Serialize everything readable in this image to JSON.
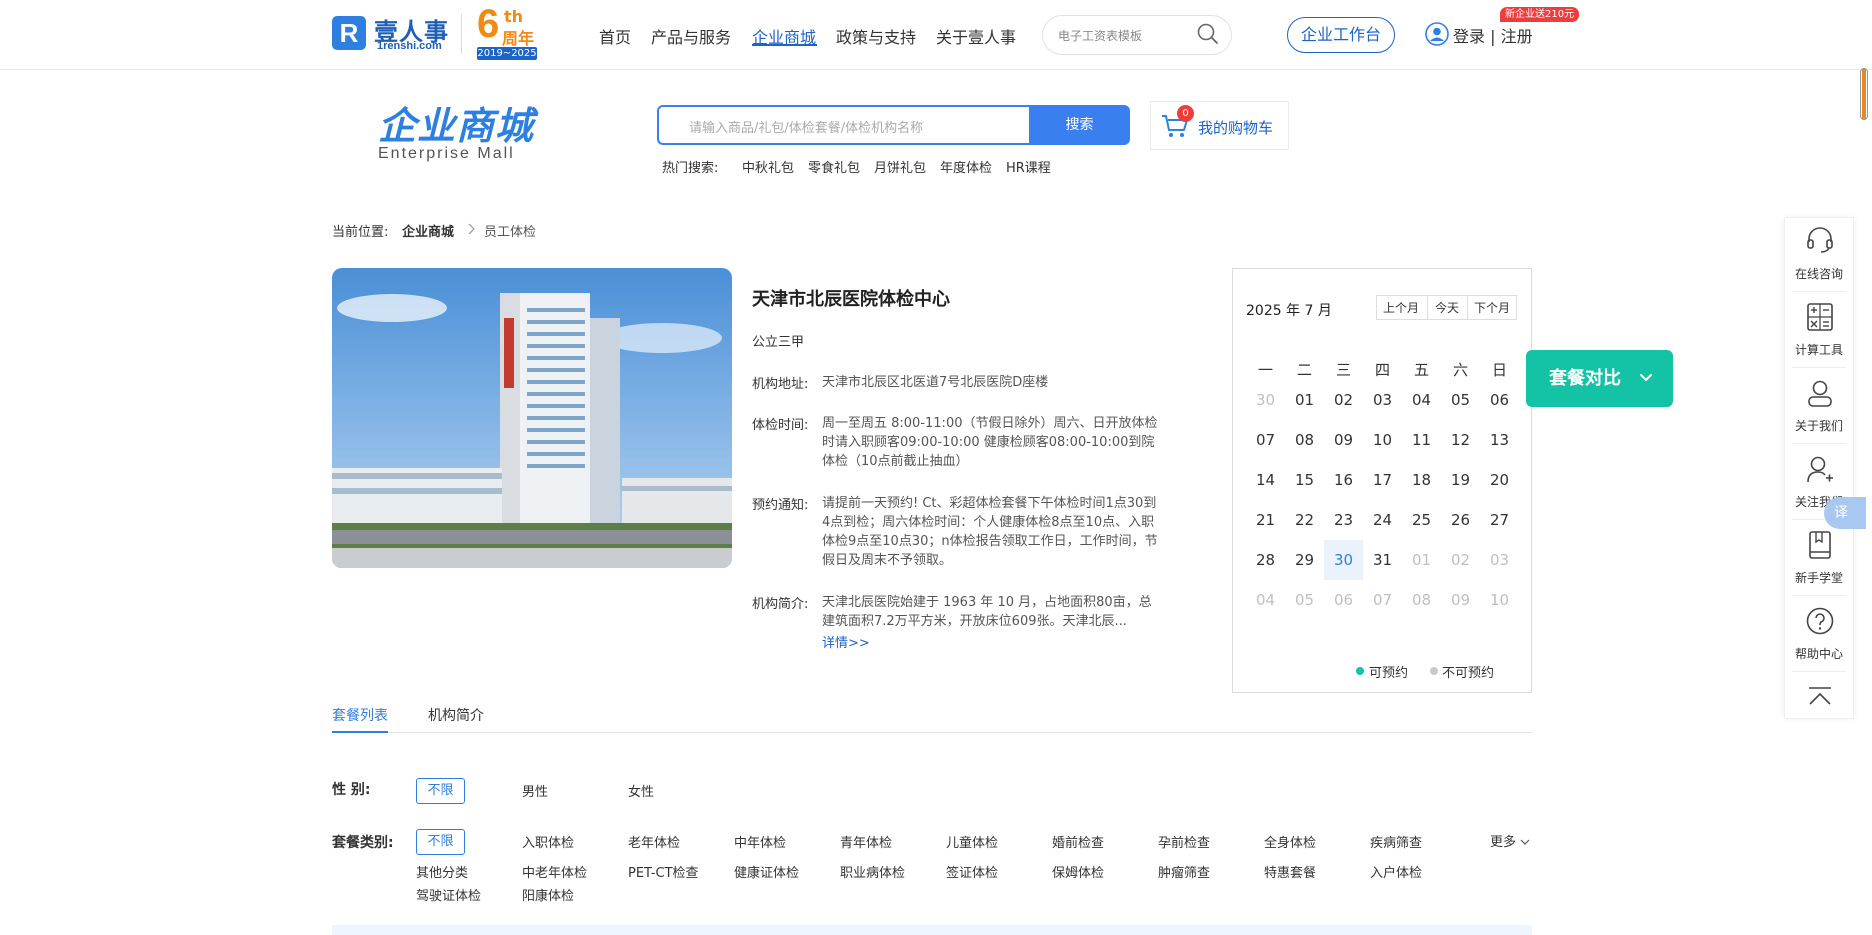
{
  "header": {
    "logo_cn": "壹人事",
    "logo_en": "1renshi.com",
    "anniversary_num": "6",
    "anniversary_th": "th",
    "anniversary_label": "周年",
    "anniversary_years": "2019~2025",
    "nav": [
      "首页",
      "产品与服务",
      "企业商城",
      "政策与支持",
      "关于壹人事"
    ],
    "nav_active": "企业商城",
    "search_placeholder": "电子工资表模板",
    "workbench_label": "企业工作台",
    "login_label": "登录 | 注册",
    "promo_badge": "新企业送210元"
  },
  "mall": {
    "title": "企业商城",
    "subtitle": "Enterprise  Mall",
    "search_placeholder": "请输入商品/礼包/体检套餐/体检机构名称",
    "search_button": "搜索",
    "cart_count": "0",
    "cart_label": "我的购物车",
    "hot_label": "热门搜索:",
    "hot_items": [
      "中秋礼包",
      "零食礼包",
      "月饼礼包",
      "年度体检",
      "HR课程"
    ]
  },
  "breadcrumb": {
    "label": "当前位置:",
    "level1": "企业商城",
    "level2": "员工体检"
  },
  "hospital": {
    "name": "天津市北辰医院体检中心",
    "grade": "公立三甲",
    "address_label": "机构地址:",
    "address": "天津市北辰区北医道7号北辰医院D座楼",
    "hours_label": "体检时间:",
    "hours": "周一至周五 8:00-11:00（节假日除外）周六、日开放体检时请入职顾客09:00-10:00 健康检顾客08:00-10:00到院体检（10点前截止抽血）",
    "notice_label": "预约通知:",
    "notice": "请提前一天预约! Ct、彩超体检套餐下午体检时间1点30到4点到检；周六体检时间：个人健康体检8点至10点、入职体检9点至10点30；n体检报告领取工作日，工作时间，节假日及周末不予领取。",
    "intro_label": "机构简介:",
    "intro": "天津北辰医院始建于 1963 年 10 月，占地面积80亩，总建筑面积7.2万平方米，开放床位609张。天津北辰...",
    "detail_link": "详情>>"
  },
  "calendar": {
    "title": "2025 年 7 月",
    "prev": "上个月",
    "today": "今天",
    "next": "下个月",
    "weekdays": [
      "一",
      "二",
      "三",
      "四",
      "五",
      "六",
      "日"
    ],
    "rows": [
      [
        "30",
        "01",
        "02",
        "03",
        "04",
        "05",
        "06"
      ],
      [
        "07",
        "08",
        "09",
        "10",
        "11",
        "12",
        "13"
      ],
      [
        "14",
        "15",
        "16",
        "17",
        "18",
        "19",
        "20"
      ],
      [
        "21",
        "22",
        "23",
        "24",
        "25",
        "26",
        "27"
      ],
      [
        "28",
        "29",
        "30",
        "31",
        "01",
        "02",
        "03"
      ],
      [
        "04",
        "05",
        "06",
        "07",
        "08",
        "09",
        "10"
      ]
    ],
    "legend_available": "可预约",
    "legend_unavailable": "不可预约",
    "color_available": "#14c3a6",
    "color_unavailable": "#c8c8c8"
  },
  "compare_label": "套餐对比",
  "tabs": [
    "套餐列表",
    "机构简介"
  ],
  "filters": {
    "gender_label": "性      别:",
    "gender_selected": "不限",
    "gender_options": [
      "男性",
      "女性"
    ],
    "category_label": "套餐类别:",
    "category_selected": "不限",
    "category_options": [
      "入职体检",
      "老年体检",
      "中年体检",
      "青年体检",
      "儿童体检",
      "婚前检查",
      "孕前检查",
      "全身体检",
      "疾病筛查",
      "其他分类",
      "中老年体检",
      "PET-CT检查",
      "健康证体检",
      "职业病体检",
      "签证体检",
      "保姆体检",
      "肿瘤筛查",
      "特惠套餐",
      "入户体检",
      "驾驶证体检",
      "阳康体检"
    ],
    "more_label": "更多"
  },
  "float_bar": [
    "在线咨询",
    "计算工具",
    "关于我们",
    "关注我们",
    "新手学堂",
    "帮助中心"
  ],
  "translate_label": "译",
  "colors": {
    "brand": "#1e63c6",
    "accent": "#2f7fe0",
    "teal": "#14c3a6",
    "orange": "#f28a12"
  }
}
